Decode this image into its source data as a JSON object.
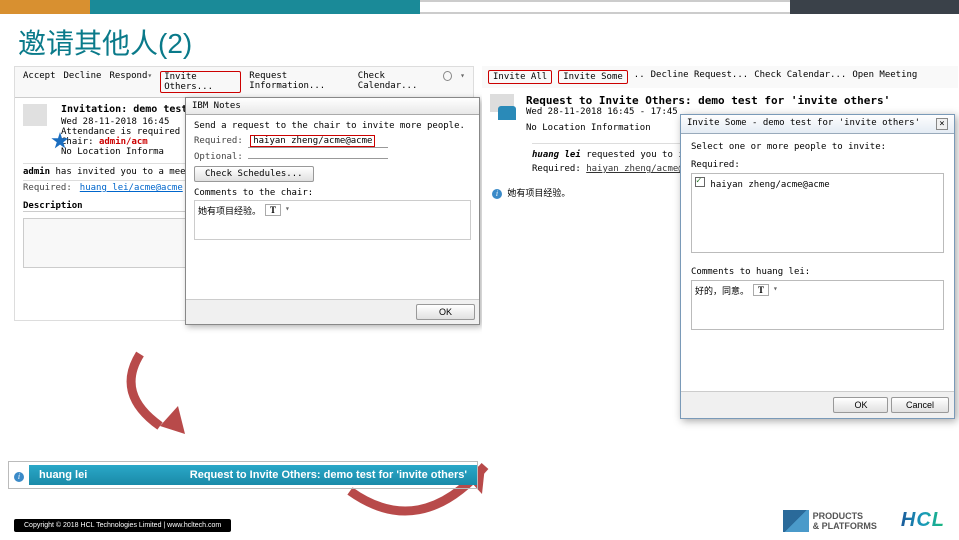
{
  "title": "邀请其他人(2)",
  "panel1": {
    "toolbar": {
      "accept": "Accept",
      "decline": "Decline",
      "respond": "Respond",
      "invite_others": "Invite Others...",
      "request_info": "Request Information...",
      "check_cal": "Check Calendar..."
    },
    "header": {
      "title": "Invitation: demo test for 'invite others'",
      "date": "Wed 28-11-2018 16:45",
      "attendance": "Attendance is required",
      "chair": "Chair:",
      "chair_val": "admin/acm",
      "noloc": "No Location Informa"
    },
    "invited_line": {
      "pre": "admin",
      "post": " has invited you to a meeting.  Yo"
    },
    "required_label": "Required:",
    "required_val": "huang lei/acme@acme",
    "description_label": "Description"
  },
  "dlg_notes": {
    "title": "IBM Notes",
    "prompt": "Send a request to the chair to invite more people.",
    "required_label": "Required:",
    "required_val": "haiyan zheng/acme@acme",
    "optional_label": "Optional:",
    "check_schedules": "Check Schedules...",
    "comments_label": "Comments to the chair:",
    "comments_val": "她有项目经验。",
    "ok": "OK"
  },
  "panel2": {
    "toolbar": {
      "invite_all": "Invite All",
      "invite_some": "Invite Some",
      "decline": "Decline Request...",
      "check_cal": "Check Calendar...",
      "open_meeting": "Open Meeting"
    },
    "header": {
      "title": "Request to Invite Others: demo test for 'invite others'",
      "date": "Wed 28-11-2018 16:45 - 17:45",
      "noloc": "No Location Information"
    },
    "body": {
      "requested": "huang lei",
      "requested_post": " requested you to invite othe",
      "required_label": "Required:",
      "required_val": "haiyan zheng/acme@acme",
      "comment": "她有项目经验。"
    }
  },
  "dlg_invite": {
    "title": "Invite Some -  demo test for 'invite others'",
    "prompt": "Select one or more people to invite:",
    "required_label": "Required:",
    "person": "haiyan zheng/acme@acme",
    "comments_label": "Comments to huang lei:",
    "comments_val": "好的，同意。",
    "ok": "OK",
    "cancel": "Cancel"
  },
  "notif": {
    "name": "huang lei",
    "subject": "Request to Invite Others: demo test for 'invite others'"
  },
  "footer": {
    "copyright": "Copyright © 2018 HCL Technologies Limited  |  www.hcltech.com",
    "pp_line1": "PRODUCTS",
    "pp_line2": "& PLATFORMS",
    "hcl": "HCL"
  }
}
